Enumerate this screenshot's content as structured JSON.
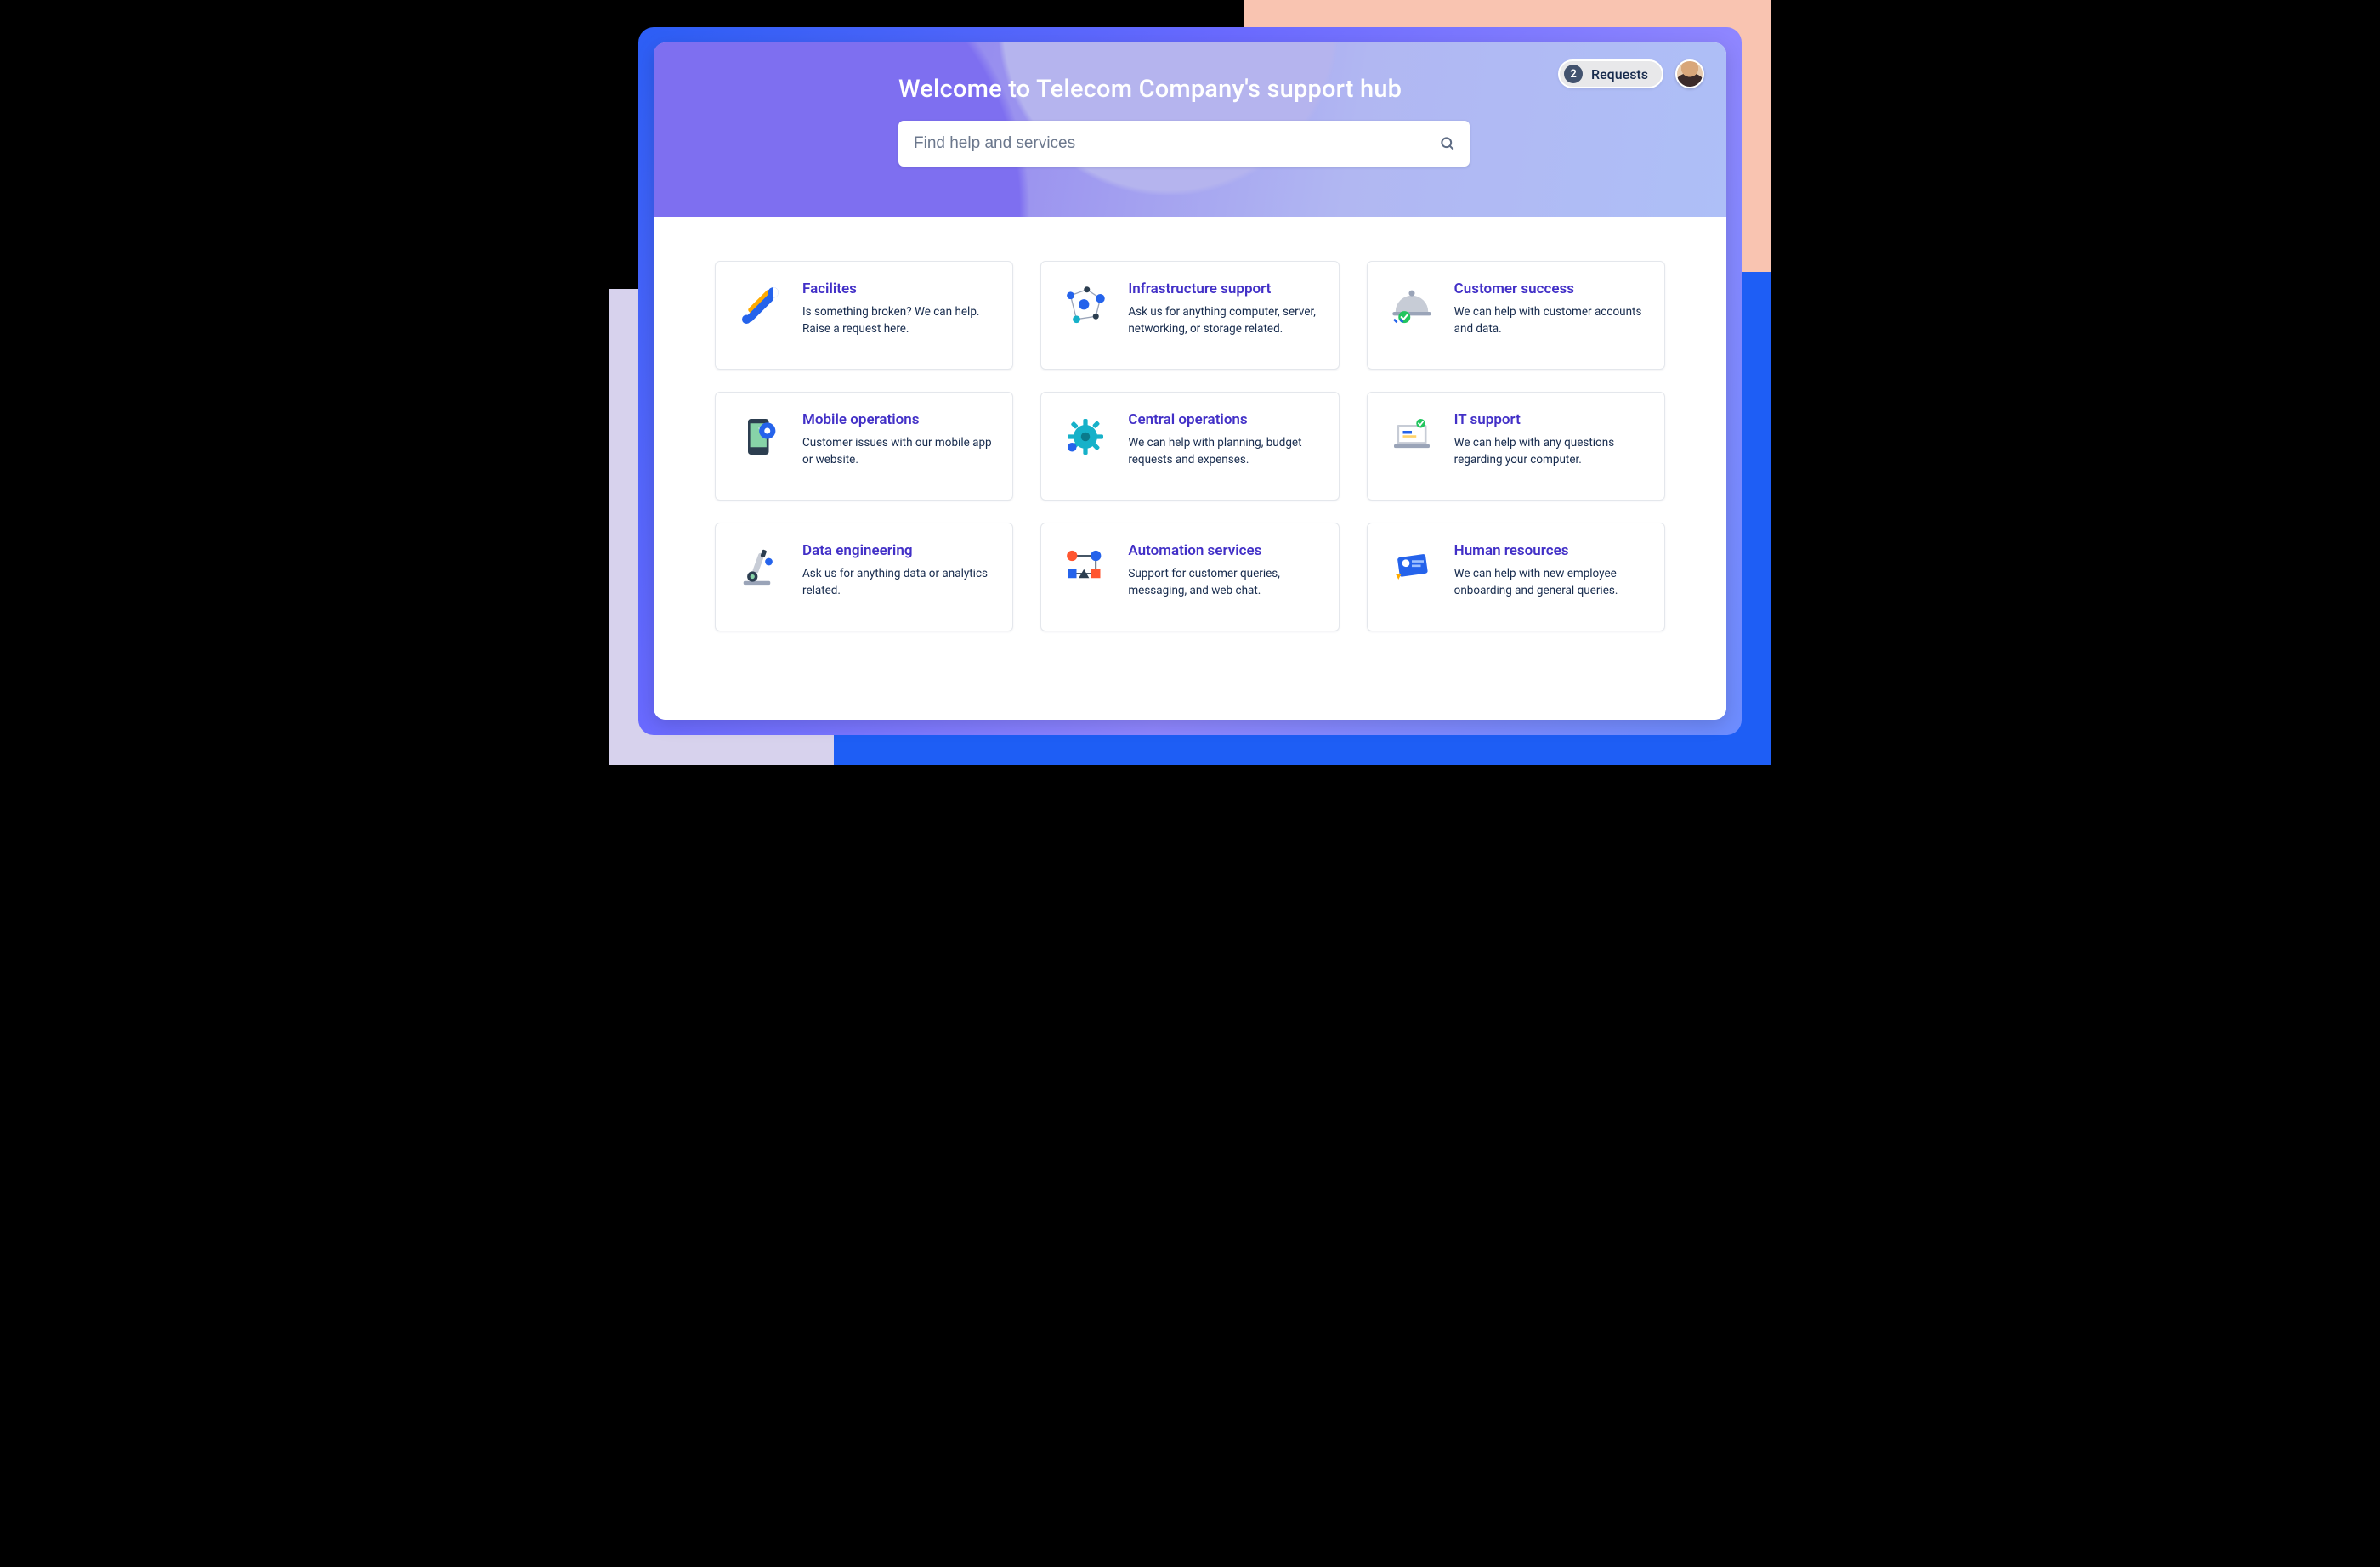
{
  "hero": {
    "title": "Welcome to Telecom Company's support hub",
    "search_placeholder": "Find help and services"
  },
  "top": {
    "requests_count": "2",
    "requests_label": "Requests"
  },
  "cards": [
    {
      "title": "Facilites",
      "desc": "Is something broken? We can help. Raise a request here.",
      "icon": "tools"
    },
    {
      "title": "Infrastructure support",
      "desc": "Ask us for anything computer, server, networking, or storage related.",
      "icon": "network"
    },
    {
      "title": "Customer success",
      "desc": "We can help with customer accounts and data.",
      "icon": "cloche"
    },
    {
      "title": "Mobile operations",
      "desc": "Customer issues with our mobile app or website.",
      "icon": "phone"
    },
    {
      "title": "Central operations",
      "desc": "We can help with planning, budget requests and expenses.",
      "icon": "gear"
    },
    {
      "title": "IT support",
      "desc": "We can help with any questions regarding your computer.",
      "icon": "laptop"
    },
    {
      "title": "Data engineering",
      "desc": "Ask us for anything data or analytics related.",
      "icon": "microscope"
    },
    {
      "title": "Automation services",
      "desc": "Support for customer queries, messaging, and web chat.",
      "icon": "flow"
    },
    {
      "title": "Human resources",
      "desc": "We can help with new employee onboarding and general queries.",
      "icon": "idcard"
    }
  ]
}
